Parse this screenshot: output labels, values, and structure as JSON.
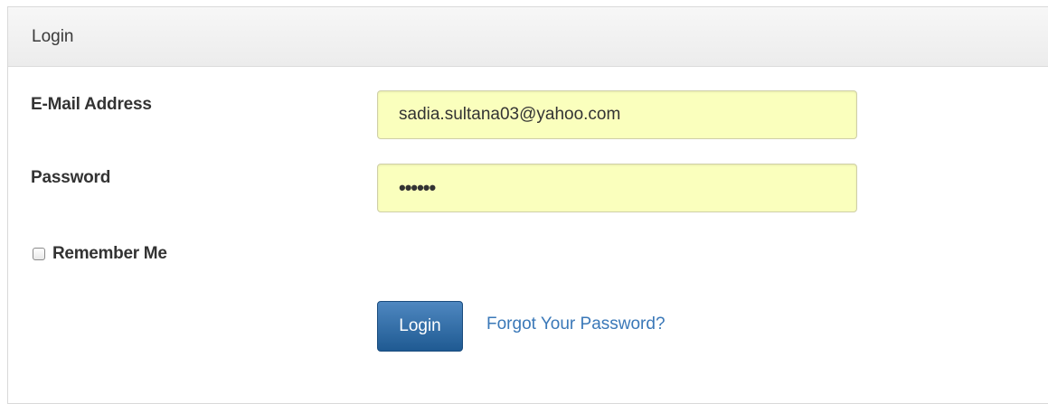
{
  "panel": {
    "title": "Login"
  },
  "form": {
    "email_label": "E-Mail Address",
    "email_value": "sadia.sultana03@yahoo.com",
    "password_label": "Password",
    "password_value": "••••••",
    "remember_label": "Remember Me",
    "remember_checked": false,
    "login_button": "Login",
    "forgot_link": "Forgot Your Password?"
  },
  "colors": {
    "autofill_background": "#faffbd",
    "button_primary": "#2d6ca8",
    "link": "#3a78b8"
  }
}
